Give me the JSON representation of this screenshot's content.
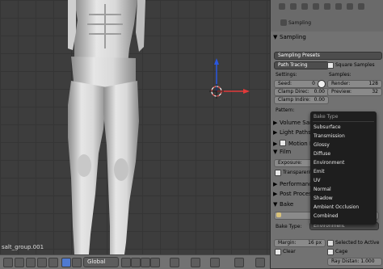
{
  "viewport": {
    "object_name": "salt_group.001",
    "transform_orientation": "Global"
  },
  "properties": {
    "data_label": "Sampling",
    "sampling_header": "Sampling",
    "sampling_presets": "Sampling Presets",
    "integrator": "Path Tracing",
    "square_samples": "Square Samples",
    "settings_label": "Settings:",
    "samples_label": "Samples:",
    "seed_label": "Seed:",
    "seed_value": "0",
    "clamp_direct_label": "Clamp Direc:",
    "clamp_direct_value": "0.00",
    "clamp_indirect_label": "Clamp Indire:",
    "clamp_indirect_value": "0.00",
    "render_label": "Render:",
    "render_value": "128",
    "preview_label": "Preview:",
    "preview_value": "32",
    "pattern_label": "Pattern:",
    "volume_sampling": "Volume Samp",
    "light_paths": "Light Paths",
    "motion_blur": "Motion Bl",
    "film": "Film",
    "exposure_label": "Exposure:",
    "transparent": "Transparent",
    "performance": "Performanc",
    "post_processing": "Post Process",
    "bake": "Bake",
    "bake_type_label": "Bake Type:",
    "bake_type_value": "Environment",
    "margin_label": "Margin:",
    "margin_value": "16 px",
    "clear": "Clear",
    "selected_to_active": "Selected to Active",
    "cage": "Cage",
    "ray_distance": "Ray Distan: 1.000"
  },
  "bake_menu": {
    "title": "Bake Type",
    "items": [
      "Subsurface",
      "Transmission",
      "Glossy",
      "Diffuse",
      "Environment",
      "Emit",
      "UV",
      "Normal",
      "Shadow",
      "Ambient Occlusion",
      "Combined"
    ]
  },
  "colors": {
    "viewport_bg": "#3d3d3d",
    "panel_bg": "#727272",
    "menu_bg": "#1e1e1e",
    "axis_x": "#e23a3a",
    "axis_z": "#2a57e0"
  }
}
